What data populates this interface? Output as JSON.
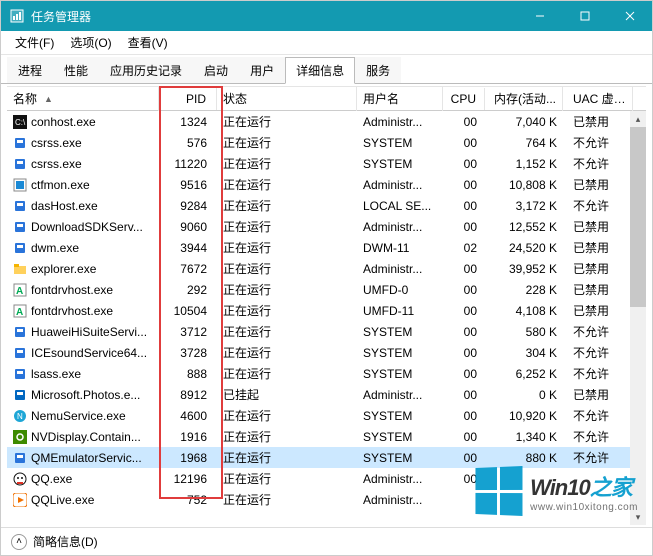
{
  "window": {
    "title": "任务管理器"
  },
  "menu": {
    "file": "文件(F)",
    "options": "选项(O)",
    "view": "查看(V)"
  },
  "tabs": {
    "items": [
      {
        "label": "进程"
      },
      {
        "label": "性能"
      },
      {
        "label": "应用历史记录"
      },
      {
        "label": "启动"
      },
      {
        "label": "用户"
      },
      {
        "label": "详细信息"
      },
      {
        "label": "服务"
      }
    ],
    "active_index": 5
  },
  "columns": {
    "name": "名称",
    "pid": "PID",
    "status": "状态",
    "user": "用户名",
    "cpu": "CPU",
    "mem": "内存(活动...",
    "uac": "UAC 虚拟化"
  },
  "rows": [
    {
      "icon": "console-icon",
      "color": "#111",
      "name": "conhost.exe",
      "pid": "1324",
      "status": "正在运行",
      "user": "Administr...",
      "cpu": "00",
      "mem": "7,040 K",
      "uac": "已禁用"
    },
    {
      "icon": "generic-icon",
      "color": "#2a74da",
      "name": "csrss.exe",
      "pid": "576",
      "status": "正在运行",
      "user": "SYSTEM",
      "cpu": "00",
      "mem": "764 K",
      "uac": "不允许"
    },
    {
      "icon": "generic-icon",
      "color": "#2a74da",
      "name": "csrss.exe",
      "pid": "11220",
      "status": "正在运行",
      "user": "SYSTEM",
      "cpu": "00",
      "mem": "1,152 K",
      "uac": "不允许"
    },
    {
      "icon": "ctfmon-icon",
      "color": "#1b8ad6",
      "name": "ctfmon.exe",
      "pid": "9516",
      "status": "正在运行",
      "user": "Administr...",
      "cpu": "00",
      "mem": "10,808 K",
      "uac": "已禁用"
    },
    {
      "icon": "generic-icon",
      "color": "#2a74da",
      "name": "dasHost.exe",
      "pid": "9284",
      "status": "正在运行",
      "user": "LOCAL SE...",
      "cpu": "00",
      "mem": "3,172 K",
      "uac": "不允许"
    },
    {
      "icon": "generic-icon",
      "color": "#2a74da",
      "name": "DownloadSDKServ...",
      "pid": "9060",
      "status": "正在运行",
      "user": "Administr...",
      "cpu": "00",
      "mem": "12,552 K",
      "uac": "已禁用"
    },
    {
      "icon": "dwm-icon",
      "color": "#2a74da",
      "name": "dwm.exe",
      "pid": "3944",
      "status": "正在运行",
      "user": "DWM-11",
      "cpu": "02",
      "mem": "24,520 K",
      "uac": "已禁用"
    },
    {
      "icon": "explorer-icon",
      "color": "#f5b400",
      "name": "explorer.exe",
      "pid": "7672",
      "status": "正在运行",
      "user": "Administr...",
      "cpu": "00",
      "mem": "39,952 K",
      "uac": "已禁用"
    },
    {
      "icon": "font-icon",
      "color": "#333",
      "name": "fontdrvhost.exe",
      "pid": "292",
      "status": "正在运行",
      "user": "UMFD-0",
      "cpu": "00",
      "mem": "228 K",
      "uac": "已禁用"
    },
    {
      "icon": "font-icon",
      "color": "#333",
      "name": "fontdrvhost.exe",
      "pid": "10504",
      "status": "正在运行",
      "user": "UMFD-11",
      "cpu": "00",
      "mem": "4,108 K",
      "uac": "已禁用"
    },
    {
      "icon": "generic-icon",
      "color": "#2a74da",
      "name": "HuaweiHiSuiteServi...",
      "pid": "3712",
      "status": "正在运行",
      "user": "SYSTEM",
      "cpu": "00",
      "mem": "580 K",
      "uac": "不允许"
    },
    {
      "icon": "generic-icon",
      "color": "#2a74da",
      "name": "ICEsoundService64...",
      "pid": "3728",
      "status": "正在运行",
      "user": "SYSTEM",
      "cpu": "00",
      "mem": "304 K",
      "uac": "不允许"
    },
    {
      "icon": "generic-icon",
      "color": "#2a74da",
      "name": "lsass.exe",
      "pid": "888",
      "status": "正在运行",
      "user": "SYSTEM",
      "cpu": "00",
      "mem": "6,252 K",
      "uac": "不允许"
    },
    {
      "icon": "photos-icon",
      "color": "#0368c1",
      "name": "Microsoft.Photos.e...",
      "pid": "8912",
      "status": "已挂起",
      "user": "Administr...",
      "cpu": "00",
      "mem": "0 K",
      "uac": "已禁用"
    },
    {
      "icon": "nemu-icon",
      "color": "#1ea6d6",
      "name": "NemuService.exe",
      "pid": "4600",
      "status": "正在运行",
      "user": "SYSTEM",
      "cpu": "00",
      "mem": "10,920 K",
      "uac": "不允许"
    },
    {
      "icon": "nvidia-icon",
      "color": "#3d8b00",
      "name": "NVDisplay.Contain...",
      "pid": "1916",
      "status": "正在运行",
      "user": "SYSTEM",
      "cpu": "00",
      "mem": "1,340 K",
      "uac": "不允许"
    },
    {
      "icon": "generic-icon",
      "color": "#2a74da",
      "name": "QMEmulatorServic...",
      "pid": "1968",
      "status": "正在运行",
      "user": "SYSTEM",
      "cpu": "00",
      "mem": "880 K",
      "uac": "不允许",
      "selected": true
    },
    {
      "icon": "qq-icon",
      "color": "#e03024",
      "name": "QQ.exe",
      "pid": "12196",
      "status": "正在运行",
      "user": "Administr...",
      "cpu": "00",
      "mem": "",
      "uac": ""
    },
    {
      "icon": "qqlive-icon",
      "color": "#f07000",
      "name": "QQLive.exe",
      "pid": "752",
      "status": "正在运行",
      "user": "Administr...",
      "cpu": "",
      "mem": "",
      "uac": ""
    }
  ],
  "footer": {
    "brief": "简略信息(D)"
  },
  "watermark": {
    "brand_en": "Win10",
    "brand_cn": "之家",
    "url": "www.win10xitong.com"
  }
}
